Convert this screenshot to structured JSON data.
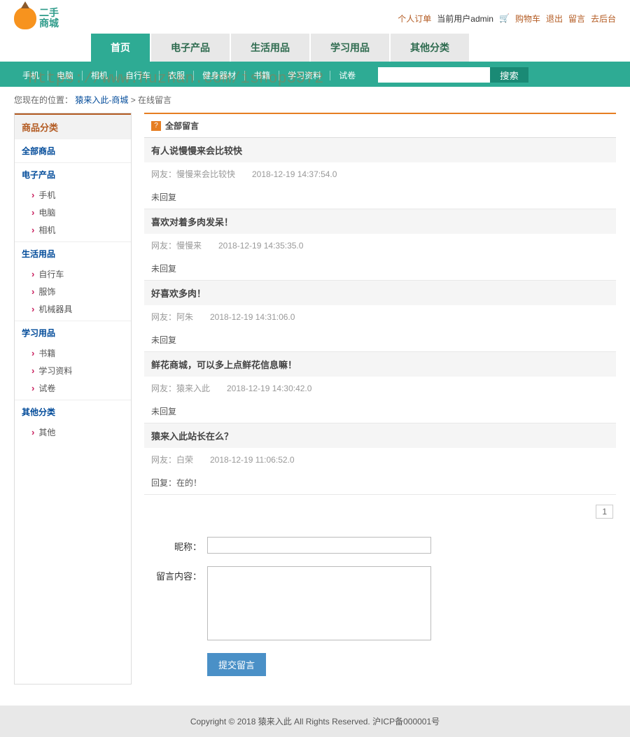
{
  "logo": {
    "line1": "二手",
    "line2": "商城"
  },
  "top_links": {
    "personal_order": "个人订单",
    "current_user_prefix": "当前用户",
    "current_user": "admin",
    "cart": "购物车",
    "logout": "退出",
    "guestbook": "留言",
    "backend": "去后台"
  },
  "nav_tabs": [
    {
      "label": "首页",
      "active": true
    },
    {
      "label": "电子产品",
      "active": false
    },
    {
      "label": "生活用品",
      "active": false
    },
    {
      "label": "学习用品",
      "active": false
    },
    {
      "label": "其他分类",
      "active": false
    }
  ],
  "sub_nav": [
    "手机",
    "电脑",
    "相机",
    "自行车",
    "衣服",
    "健身器材",
    "书籍",
    "学习资料",
    "试卷"
  ],
  "search": {
    "placeholder": "",
    "button": "搜索"
  },
  "breadcrumb": {
    "prefix": "您现在的位置：",
    "link": "猿来入此-商城",
    "sep": " > ",
    "current": "在线留言"
  },
  "watermark": "https://www.huzhan.com/ishop3572",
  "sidebar": {
    "header": "商品分类",
    "groups": [
      {
        "title": "全部商品",
        "items": []
      },
      {
        "title": "电子产品",
        "items": [
          "手机",
          "电脑",
          "相机"
        ]
      },
      {
        "title": "生活用品",
        "items": [
          "自行车",
          "服饰",
          "机械器具"
        ]
      },
      {
        "title": "学习用品",
        "items": [
          "书籍",
          "学习资料",
          "试卷"
        ]
      },
      {
        "title": "其他分类",
        "items": [
          "其他"
        ]
      }
    ]
  },
  "section": {
    "title": "全部留言",
    "icon_glyph": "?"
  },
  "messages": [
    {
      "title": "有人说慢慢来会比较快",
      "user_prefix": "网友：",
      "user": "慢慢来会比较快",
      "time": "2018-12-19 14:37:54.0",
      "reply": "未回复"
    },
    {
      "title": "喜欢对着多肉发呆！",
      "user_prefix": "网友：",
      "user": "慢慢来",
      "time": "2018-12-19 14:35:35.0",
      "reply": "未回复"
    },
    {
      "title": "好喜欢多肉！",
      "user_prefix": "网友：",
      "user": "阿朱",
      "time": "2018-12-19 14:31:06.0",
      "reply": "未回复"
    },
    {
      "title": "鲜花商城，可以多上点鲜花信息嘛！",
      "user_prefix": "网友：",
      "user": "猿来入此",
      "time": "2018-12-19 14:30:42.0",
      "reply": "未回复"
    },
    {
      "title": "猿来入此站长在么？",
      "user_prefix": "网友：",
      "user": "白荣",
      "time": "2018-12-19 11:06:52.0",
      "reply": "回复：在的！"
    }
  ],
  "pagination": {
    "current": "1"
  },
  "form": {
    "nickname_label": "昵称：",
    "content_label": "留言内容：",
    "submit": "提交留言"
  },
  "footer": "Copyright © 2018 猿来入此 All Rights Reserved. 沪ICP备000001号"
}
